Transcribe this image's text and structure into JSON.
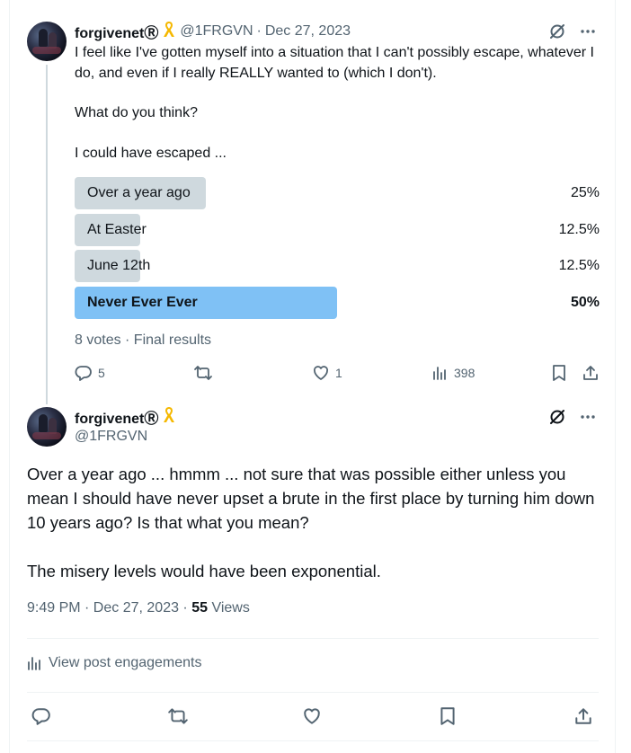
{
  "post1": {
    "display_name": "forgivenetⓇ",
    "handle": "@1FRGVN",
    "date": "Dec 27, 2023",
    "separator": "·",
    "paragraphs": [
      "I feel like I've gotten myself into a situation that I can't possibly escape, whatever I do, and even if I really REALLY wanted to (which I don't).",
      "What do you think?",
      "I could have escaped ..."
    ],
    "poll": {
      "options": [
        {
          "label": "Over a year ago",
          "percent": "25%",
          "share": 0.25,
          "winner": false
        },
        {
          "label": "At Easter",
          "percent": "12.5%",
          "share": 0.125,
          "winner": false
        },
        {
          "label": "June 12th",
          "percent": "12.5%",
          "share": 0.125,
          "winner": false
        },
        {
          "label": "Never Ever Ever",
          "percent": "50%",
          "share": 0.5,
          "winner": true
        }
      ],
      "footer": "8 votes · Final results"
    },
    "actions": {
      "replies": "5",
      "likes": "1",
      "views": "398"
    }
  },
  "post2": {
    "display_name": "forgivenetⓇ",
    "handle": "@1FRGVN",
    "paragraphs": [
      "Over a year ago ... hmmm ... not sure that was possible either unless you mean I should have never upset a brute in the first place by turning him down 10 years ago? Is that what you mean?",
      "The misery levels would have been exponential."
    ],
    "timestamp": "9:49 PM · Dec 27, 2023",
    "dot": " · ",
    "views_count": "55",
    "views_label": "Views",
    "engagements_link": "View post engagements"
  },
  "colors": {
    "bar_default": "#cfd9de",
    "bar_winner": "#7fc1f5",
    "muted_text": "#536471",
    "primary_text": "#0f1419",
    "ribbon": "#f5b800"
  },
  "icons": [
    "ribbon-icon",
    "grok-icon",
    "more-icon",
    "reply-icon",
    "repost-icon",
    "like-icon",
    "views-icon",
    "bookmark-icon",
    "share-icon"
  ]
}
